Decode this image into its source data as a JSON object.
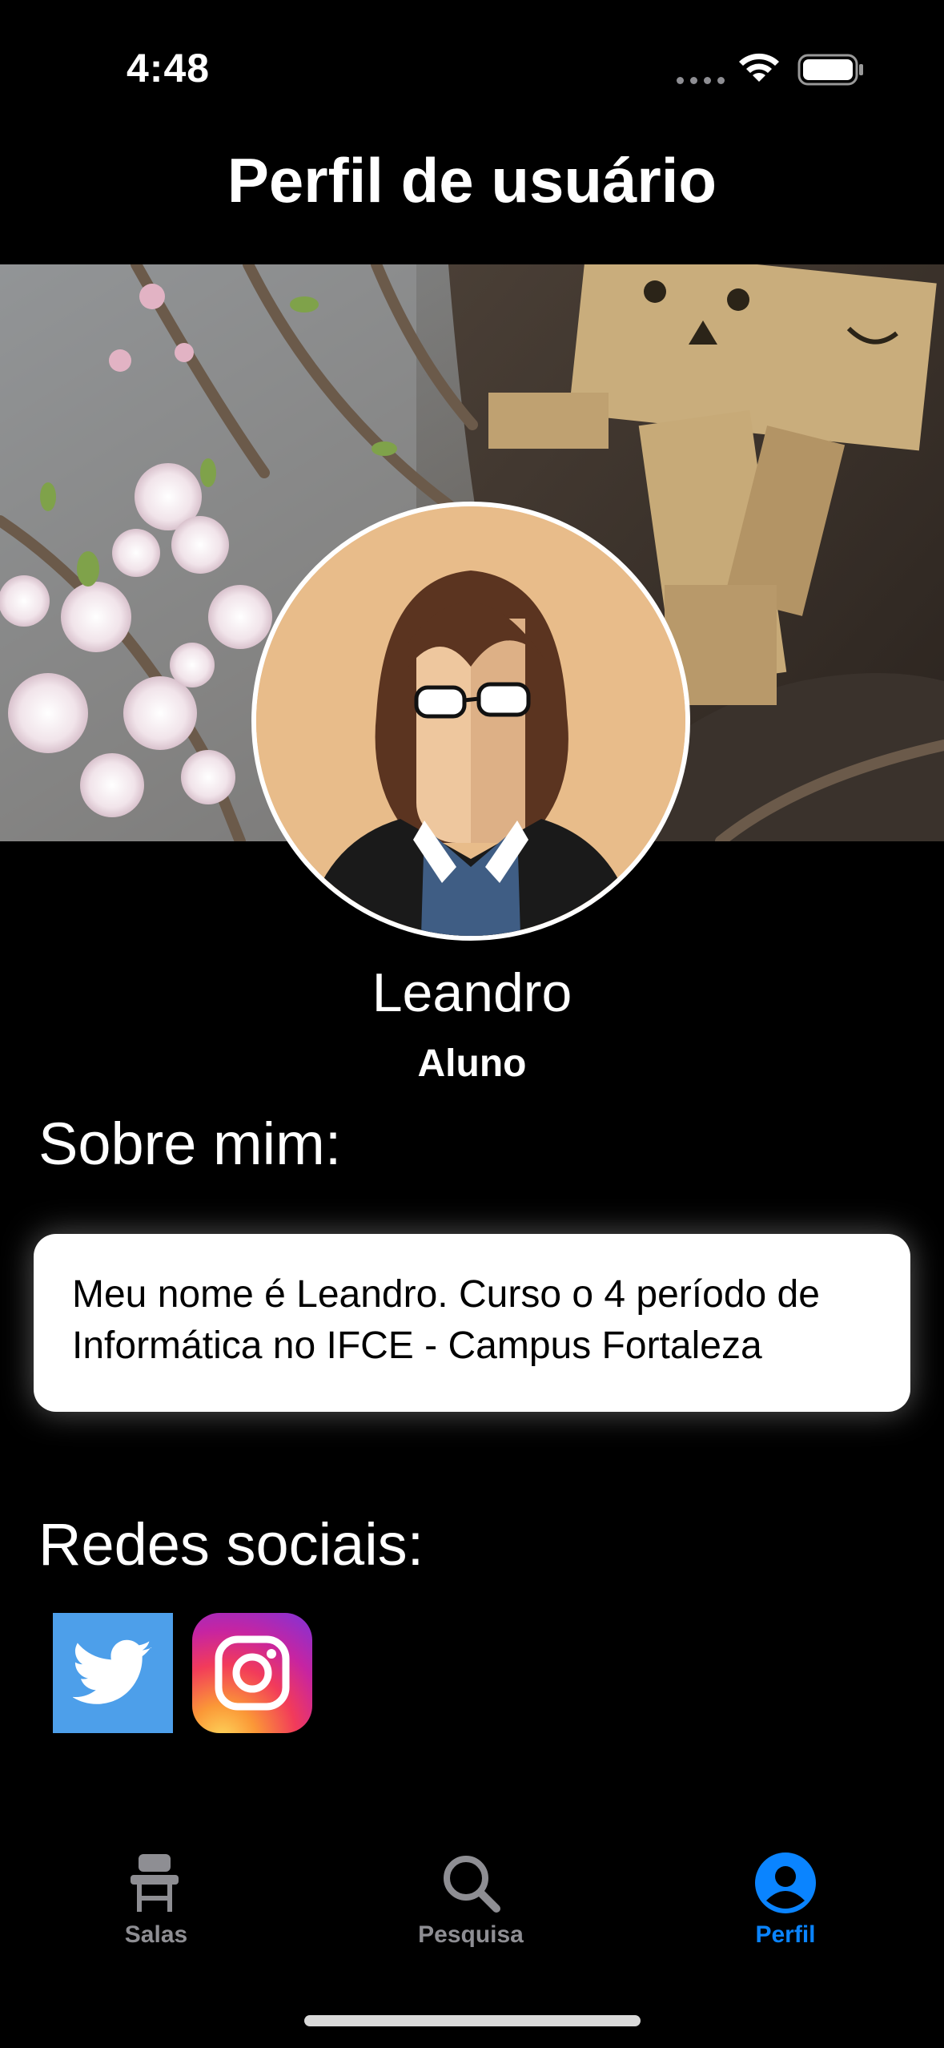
{
  "status_bar": {
    "time": "4:48"
  },
  "header": {
    "title": "Perfil de usuário"
  },
  "profile": {
    "name": "Leandro",
    "role": "Aluno"
  },
  "about": {
    "title": "Sobre mim:",
    "text": "Meu nome é Leandro. Curso o 4 período de Informática no IFCE - Campus Fortaleza"
  },
  "social": {
    "title": "Redes sociais:",
    "items": [
      {
        "name": "twitter",
        "icon": "twitter-bird-icon",
        "color": "#4d9fea"
      },
      {
        "name": "instagram",
        "icon": "instagram-camera-icon"
      }
    ]
  },
  "tabs": [
    {
      "label": "Salas",
      "icon": "school-desk-icon",
      "active": false
    },
    {
      "label": "Pesquisa",
      "icon": "magnifier-icon",
      "active": false
    },
    {
      "label": "Perfil",
      "icon": "person-circle-icon",
      "active": true
    }
  ],
  "colors": {
    "accent": "#0a84ff",
    "inactive": "#8e8e93",
    "background": "#000000"
  }
}
